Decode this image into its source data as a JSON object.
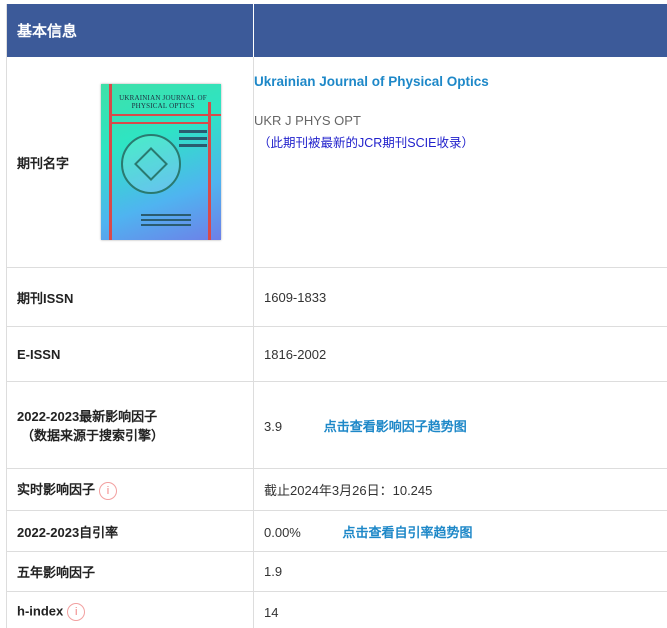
{
  "header": {
    "title": "基本信息"
  },
  "journal": {
    "label": "期刊名字",
    "full_name": "Ukrainian Journal of Physical Optics",
    "abbr": "UKR J PHYS OPT",
    "note": "（此期刊被最新的JCR期刊SCIE收录）",
    "cover_title": "UKRAINIAN JOURNAL OF PHYSICAL OPTICS"
  },
  "issn": {
    "label": "期刊ISSN",
    "value": "1609-1833"
  },
  "eissn": {
    "label": "E-ISSN",
    "value": "1816-2002"
  },
  "impact": {
    "label": "2022-2023最新影响因子",
    "label_sub": "（数据来源于搜索引擎）",
    "value": "3.9",
    "link": "点击查看影响因子趋势图"
  },
  "realtime": {
    "label": "实时影响因子",
    "value": "截止2024年3月26日：10.245",
    "icon": "info-icon"
  },
  "self_cite": {
    "label": "2022-2023自引率",
    "value": "0.00%",
    "link": "点击查看自引率趋势图"
  },
  "five_year": {
    "label": "五年影响因子",
    "value": "1.9"
  },
  "h_index": {
    "label": "h-index",
    "value": "14",
    "icon": "info-icon"
  },
  "colors": {
    "header_bg": "#3c5a99",
    "link": "#1e88c8",
    "note": "#2222cc",
    "info_icon": "#f08080"
  }
}
